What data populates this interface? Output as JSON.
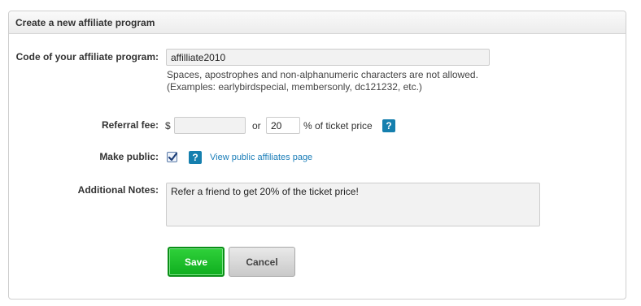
{
  "panel": {
    "title": "Create a new affiliate program"
  },
  "code": {
    "label": "Code of your affiliate program:",
    "value": "affilliate2010",
    "hint_line1": "Spaces, apostrophes and non-alphanumeric characters are not allowed.",
    "hint_line2": "(Examples: earlybirdspecial, membersonly, dc121232, etc.)"
  },
  "fee": {
    "label": "Referral fee:",
    "currency": "$",
    "amount_value": "",
    "or_text": "or",
    "percent_value": "20",
    "percent_suffix": "% of ticket price",
    "help": "?"
  },
  "public": {
    "label": "Make public:",
    "checked": true,
    "help": "?",
    "link_text": "View public affiliates page"
  },
  "notes": {
    "label": "Additional Notes:",
    "value": "Refer a friend to get 20% of the ticket price!"
  },
  "actions": {
    "save_label": "Save",
    "cancel_label": "Cancel"
  },
  "colors": {
    "save_green": "#1abf2a",
    "help_blue": "#157fae",
    "link_blue": "#1a7db8"
  }
}
